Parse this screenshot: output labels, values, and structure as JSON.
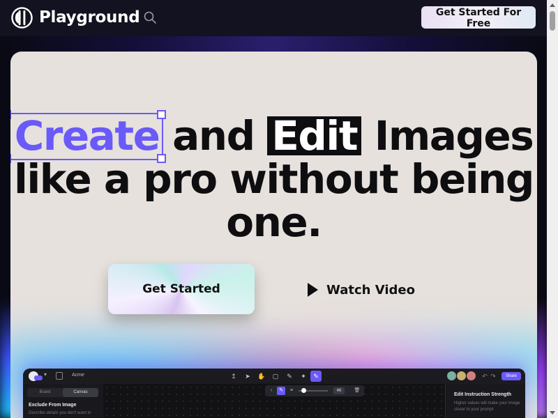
{
  "header": {
    "brand": "Playground",
    "cta_label": "Get Started For Free",
    "logo_icon": "playground-logo-icon",
    "search_icon": "search-icon"
  },
  "hero": {
    "headline": {
      "word_create": "Create",
      "word_and": "and",
      "word_edit": "Edit",
      "word_images": "Images",
      "line2": "like a pro without being",
      "line3": "one."
    },
    "primary_button": "Get Started",
    "secondary_button": "Watch Video"
  },
  "app_preview": {
    "project_name": "Acme",
    "share_label": "Share",
    "segments": [
      "Board",
      "Canvas"
    ],
    "left_panel_title": "Exclude From Image",
    "left_panel_desc": "Describe details you don't want in",
    "slider_value": "46",
    "right_panel_title": "Edit Instruction Strength",
    "right_panel_desc": "Higher values will make your image closer to your prompt"
  },
  "colors": {
    "accent": "#6a5af9",
    "topbar": "#121220",
    "hero_bg": "#e6e1dd",
    "text_dark": "#0e0e10"
  }
}
